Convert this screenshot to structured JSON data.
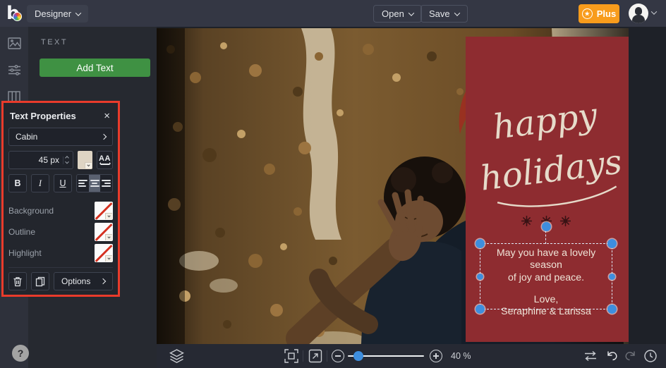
{
  "topbar": {
    "app_menu_label": "Designer",
    "open_label": "Open",
    "save_label": "Save",
    "plus_label": "Plus",
    "star_icon": "★"
  },
  "colors": {
    "accent_orange": "#F89C1C",
    "button_green": "#3F9143",
    "card_red": "#8E2C30",
    "annotation_red": "#E93B2B",
    "handle_blue": "#3E8EDE",
    "font_color_swatch": "#DED4C3"
  },
  "text_panel": {
    "header": "TEXT",
    "add_text_label": "Add Text"
  },
  "text_properties": {
    "title": "Text Properties",
    "close_icon": "×",
    "font_name": "Cabin",
    "font_size": "45 px",
    "bold_label": "B",
    "italic_label": "I",
    "underline_label": "U",
    "letter_spacing_label": "AA",
    "background_label": "Background",
    "outline_label": "Outline",
    "highlight_label": "Highlight",
    "options_label": "Options"
  },
  "canvas": {
    "card_title_line1": "happy",
    "card_title_line2": "holidays",
    "card_message_line1": "May you have a lovely season",
    "card_message_line2": "of joy and peace.",
    "card_message_line3": "Love,",
    "card_message_line4": "Seraphine & Larissa"
  },
  "bottom_bar": {
    "zoom_level": "40 %"
  },
  "help": {
    "label": "?"
  }
}
